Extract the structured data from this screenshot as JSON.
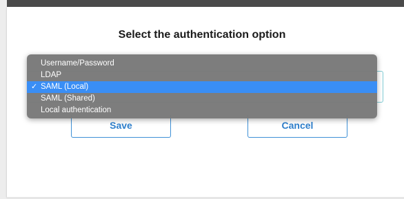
{
  "dialog": {
    "title": "Select the authentication option"
  },
  "dropdown": {
    "options": [
      "Username/Password",
      "LDAP",
      "SAML (Local)",
      "SAML (Shared)",
      "Local authentication"
    ],
    "selected_index": 2,
    "selected_value": "SAML (Local)",
    "check_glyph": "✓"
  },
  "buttons": {
    "save_label": "Save",
    "cancel_label": "Cancel"
  },
  "colors": {
    "accent": "#3a8ef5",
    "button_text": "#2e7fcc",
    "select_border": "#7fcbd4",
    "menu_background": "#797979"
  }
}
